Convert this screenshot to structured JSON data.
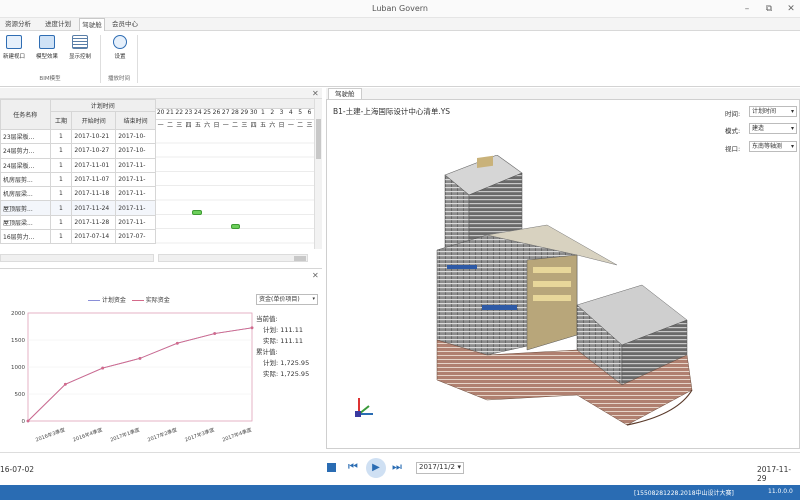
{
  "window": {
    "title": "Luban Govern",
    "min_icon": "minimize-icon",
    "max_icon": "maximize-icon",
    "close_icon": "close-icon"
  },
  "tabs": [
    {
      "label": "资源分析",
      "active": false
    },
    {
      "label": "进度计划",
      "active": false
    },
    {
      "label": "驾驶舱",
      "active": true
    },
    {
      "label": "会员中心",
      "active": false
    }
  ],
  "ribbon": {
    "buttons": [
      {
        "label": "新建视口",
        "icon": "new-viewport-icon"
      },
      {
        "label": "模型效果",
        "icon": "model-effect-icon"
      },
      {
        "label": "显示控制",
        "icon": "display-control-icon"
      },
      {
        "label": "设置",
        "icon": "settings-icon"
      }
    ],
    "groups": [
      {
        "label": "BIM模型"
      },
      {
        "label": "播放时间"
      }
    ]
  },
  "gantt": {
    "header": {
      "task_name": "任务名称",
      "plan_time": "计划时间",
      "duration": "工期",
      "start": "开始时间",
      "end": "结束时间"
    },
    "days": [
      "20",
      "21",
      "22",
      "23",
      "24",
      "25",
      "26",
      "27",
      "28",
      "29",
      "30",
      "1",
      "2",
      "3",
      "4",
      "5",
      "6"
    ],
    "weekdays": [
      "一",
      "二",
      "三",
      "四",
      "五",
      "六",
      "日",
      "一",
      "二",
      "三",
      "四",
      "五",
      "六",
      "日",
      "一",
      "二",
      "三"
    ],
    "rows": [
      {
        "name": "23层梁板...",
        "duration": "1",
        "start": "2017-10-21",
        "end": "2017-10-"
      },
      {
        "name": "24层剪力...",
        "duration": "1",
        "start": "2017-10-27",
        "end": "2017-10-"
      },
      {
        "name": "24层梁板...",
        "duration": "1",
        "start": "2017-11-01",
        "end": "2017-11-"
      },
      {
        "name": "机房层剪...",
        "duration": "1",
        "start": "2017-11-07",
        "end": "2017-11-"
      },
      {
        "name": "机房层梁...",
        "duration": "1",
        "start": "2017-11-18",
        "end": "2017-11-"
      },
      {
        "name": "屋顶层剪...",
        "duration": "1",
        "start": "2017-11-24",
        "end": "2017-11-"
      },
      {
        "name": "屋顶层梁...",
        "duration": "1",
        "start": "2017-11-28",
        "end": "2017-11-"
      },
      {
        "name": "16层剪力...",
        "duration": "1",
        "start": "2017-07-14",
        "end": "2017-07-"
      }
    ]
  },
  "chart_panel": {
    "dropdown": "资金(单价项目)",
    "current_label": "当前值:",
    "current_plan": "计划:  111.11",
    "current_actual": "实际:  111.11",
    "cumulative_label": "累计值:",
    "cumulative_plan": "计划:  1,725.95",
    "cumulative_actual": "实际:  1,725.95"
  },
  "chart_data": {
    "type": "line",
    "categories": [
      "2016年3季度",
      "2016年4季度",
      "2017年1季度",
      "2017年2季度",
      "2017年3季度",
      "2017年4季度"
    ],
    "series": [
      {
        "name": "计划资金",
        "values": [
          0,
          680,
          980,
          1160,
          1440,
          1620,
          1725.95
        ]
      },
      {
        "name": "实际资金",
        "values": [
          0,
          680,
          980,
          1160,
          1440,
          1620,
          1725.95
        ]
      }
    ],
    "y_ticks": [
      "0",
      "500",
      "1000",
      "1500",
      "2000"
    ],
    "ylim": [
      0,
      2000
    ],
    "colors": {
      "plan": "#8a8fd8",
      "actual": "#d46a8a"
    }
  },
  "view3d": {
    "tab_label": "驾驶舱",
    "model_title": "B1-土建-上海国际设计中心清单.YS",
    "time_label": "时间:",
    "time_value": "计划时间",
    "mode_label": "模式:",
    "mode_value": "建造",
    "viewport_label": "视口:",
    "viewport_value": "东南等轴测"
  },
  "playback": {
    "start_date": "16-07-02",
    "end_date": "2017-11-29",
    "current_date": "2017/11/2"
  },
  "status": {
    "left": "[15508281228.2018中山设计大赛]",
    "version": "11.0.0.0"
  }
}
